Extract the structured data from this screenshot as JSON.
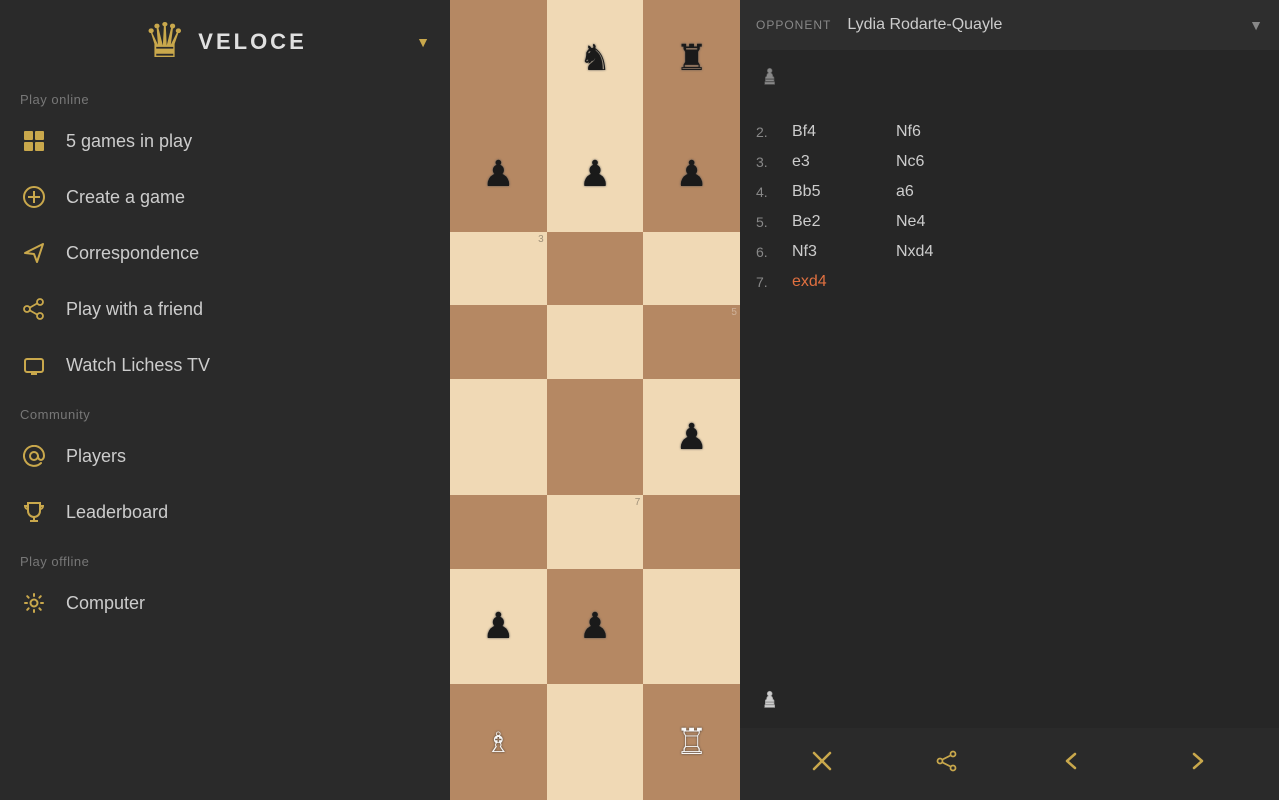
{
  "sidebar": {
    "title": "VELOCE",
    "logo_unicode": "♙",
    "play_online_label": "Play online",
    "items_online": [
      {
        "id": "games-in-play",
        "label": "5 games in play",
        "icon": "grid"
      },
      {
        "id": "create-game",
        "label": "Create a game",
        "icon": "plus-circle"
      },
      {
        "id": "correspondence",
        "label": "Correspondence",
        "icon": "paper-plane"
      },
      {
        "id": "play-friend",
        "label": "Play with a friend",
        "icon": "share"
      },
      {
        "id": "watch-tv",
        "label": "Watch Lichess TV",
        "icon": "tv"
      }
    ],
    "community_label": "Community",
    "items_community": [
      {
        "id": "players",
        "label": "Players",
        "icon": "at"
      },
      {
        "id": "leaderboard",
        "label": "Leaderboard",
        "icon": "trophy"
      }
    ],
    "play_offline_label": "Play offline",
    "items_offline": [
      {
        "id": "computer",
        "label": "Computer",
        "icon": "gear"
      }
    ]
  },
  "game": {
    "opponent_label": "OPPONENT",
    "opponent_name": "Lydia Rodarte-Quayle",
    "moves": [
      {
        "number": "2.",
        "white": "Bf4",
        "black": "Nf6"
      },
      {
        "number": "3.",
        "white": "e3",
        "black": "Nc6"
      },
      {
        "number": "4.",
        "white": "Bb5",
        "black": "a6"
      },
      {
        "number": "5.",
        "white": "Be2",
        "black": "Ne4"
      },
      {
        "number": "6.",
        "white": "Nf3",
        "black": "Nxd4"
      },
      {
        "number": "7.",
        "white": "exd4",
        "black": ""
      }
    ],
    "action_buttons": {
      "resign": "✕",
      "share": "⋙",
      "back": "‹",
      "forward": "›"
    }
  }
}
